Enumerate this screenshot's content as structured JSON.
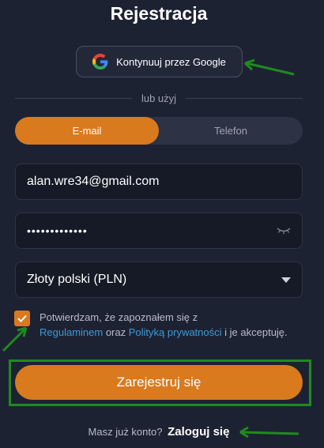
{
  "page": {
    "title": "Rejestracja"
  },
  "google": {
    "label": "Kontynuuj przez Google",
    "icon": "google-icon"
  },
  "divider": {
    "label": "lub użyj"
  },
  "tabs": [
    {
      "label": "E-mail",
      "active": true
    },
    {
      "label": "Telefon",
      "active": false
    }
  ],
  "form": {
    "email_value": "alan.wre34@gmail.com",
    "password_mask": "•••••••••••••",
    "currency_value": "Złoty polski (PLN)"
  },
  "consent": {
    "checked": true,
    "text_before": "Potwierdzam, że zapoznałem się z",
    "link_terms": "Regulaminem",
    "text_mid": "oraz",
    "link_privacy": "Polityką prywatności",
    "text_after": "i je akceptuję."
  },
  "submit": {
    "label": "Zarejestruj się"
  },
  "login": {
    "prompt": "Masz już konto?",
    "link": "Zaloguj się"
  },
  "colors": {
    "background": "#1d2233",
    "accent": "#d97a1e",
    "link": "#3a9bd8",
    "annotation": "#1f8a1f"
  }
}
